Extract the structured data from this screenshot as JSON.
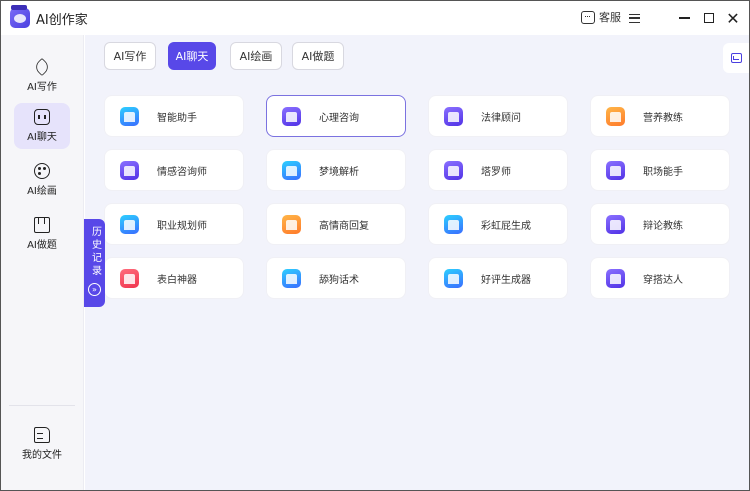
{
  "app": {
    "title": "AI创作家"
  },
  "titlebar": {
    "service_label": "客服"
  },
  "sidebar": {
    "items": [
      {
        "label": "AI写作",
        "icon": "pen-icon"
      },
      {
        "label": "AI聊天",
        "icon": "chat-bot-icon"
      },
      {
        "label": "AI绘画",
        "icon": "palette-icon"
      },
      {
        "label": "AI做题",
        "icon": "book-icon"
      }
    ],
    "bottom": {
      "label": "我的文件",
      "icon": "file-icon"
    }
  },
  "tabs": [
    {
      "label": "AI写作",
      "active": false
    },
    {
      "label": "AI聊天",
      "active": true
    },
    {
      "label": "AI绘画",
      "active": false
    },
    {
      "label": "AI做题",
      "active": false
    }
  ],
  "history_tab": {
    "label": "历史记录"
  },
  "cards": [
    {
      "label": "智能助手",
      "color": "blue"
    },
    {
      "label": "心理咨询",
      "color": "purple",
      "selected": true
    },
    {
      "label": "法律顾问",
      "color": "purple"
    },
    {
      "label": "营养教练",
      "color": "orange"
    },
    {
      "label": "情感咨询师",
      "color": "purple"
    },
    {
      "label": "梦境解析",
      "color": "blue"
    },
    {
      "label": "塔罗师",
      "color": "purple"
    },
    {
      "label": "职场能手",
      "color": "purple"
    },
    {
      "label": "职业规划师",
      "color": "blue"
    },
    {
      "label": "高情商回复",
      "color": "orange"
    },
    {
      "label": "彩虹屁生成",
      "color": "blue"
    },
    {
      "label": "辩论教练",
      "color": "purple"
    },
    {
      "label": "表白神器",
      "color": "red"
    },
    {
      "label": "舔狗话术",
      "color": "blue"
    },
    {
      "label": "好评生成器",
      "color": "blue"
    },
    {
      "label": "穿搭达人",
      "color": "purple"
    }
  ],
  "colors": {
    "accent": "#5848e8",
    "sidebar_active": "#e6e3fb",
    "main_bg": "#f2f3fb"
  }
}
